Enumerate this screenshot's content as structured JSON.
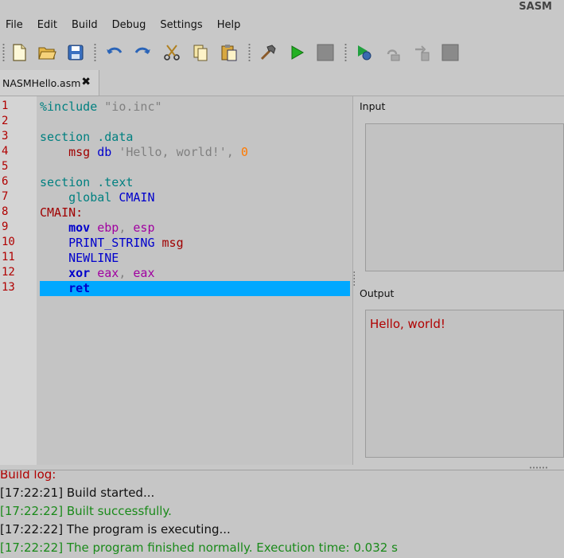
{
  "window": {
    "title": "SASM"
  },
  "menu": [
    "File",
    "Edit",
    "Build",
    "Debug",
    "Settings",
    "Help"
  ],
  "toolbar": {
    "icons": [
      "new-file-icon",
      "open-folder-icon",
      "save-icon",
      "undo-icon",
      "redo-icon",
      "cut-icon",
      "copy-icon",
      "paste-icon",
      "build-icon",
      "run-icon",
      "stop-icon",
      "debug-icon",
      "step-over-icon",
      "step-into-icon",
      "debug-stop-icon"
    ]
  },
  "tab": {
    "label": "NASMHello.asm",
    "close": "✖"
  },
  "editor": {
    "line_numbers": [
      "1",
      "2",
      "3",
      "4",
      "5",
      "6",
      "7",
      "8",
      "9",
      "10",
      "11",
      "12",
      "13"
    ],
    "highlighted_line": 13,
    "lines": [
      [
        {
          "t": "%include ",
          "c": "t-dir"
        },
        {
          "t": "\"io.inc\"",
          "c": "t-str"
        }
      ],
      [],
      [
        {
          "t": "section .data",
          "c": "t-dir"
        }
      ],
      [
        {
          "t": "    ",
          "c": "t-plain"
        },
        {
          "t": "msg",
          "c": "t-lab"
        },
        {
          "t": " ",
          "c": "t-plain"
        },
        {
          "t": "db",
          "c": "t-kw"
        },
        {
          "t": " 'Hello, world!', ",
          "c": "t-str"
        },
        {
          "t": "0",
          "c": "t-num"
        }
      ],
      [],
      [
        {
          "t": "section .text",
          "c": "t-dir"
        }
      ],
      [
        {
          "t": "    global ",
          "c": "t-dir"
        },
        {
          "t": "CMAIN",
          "c": "t-kw"
        }
      ],
      [
        {
          "t": "CMAIN:",
          "c": "t-lab"
        }
      ],
      [
        {
          "t": "    ",
          "c": "t-plain"
        },
        {
          "t": "mov",
          "c": "t-kwb"
        },
        {
          "t": " ",
          "c": "t-plain"
        },
        {
          "t": "ebp",
          "c": "t-reg"
        },
        {
          "t": ", ",
          "c": "t-str"
        },
        {
          "t": "esp",
          "c": "t-reg"
        }
      ],
      [
        {
          "t": "    ",
          "c": "t-plain"
        },
        {
          "t": "PRINT_STRING",
          "c": "t-kw"
        },
        {
          "t": " ",
          "c": "t-plain"
        },
        {
          "t": "msg",
          "c": "t-lab"
        }
      ],
      [
        {
          "t": "    ",
          "c": "t-plain"
        },
        {
          "t": "NEWLINE",
          "c": "t-kw"
        }
      ],
      [
        {
          "t": "    ",
          "c": "t-plain"
        },
        {
          "t": "xor",
          "c": "t-kwb"
        },
        {
          "t": " ",
          "c": "t-plain"
        },
        {
          "t": "eax",
          "c": "t-reg"
        },
        {
          "t": ", ",
          "c": "t-str"
        },
        {
          "t": "eax",
          "c": "t-reg"
        }
      ],
      [
        {
          "t": "    ",
          "c": "t-plain"
        },
        {
          "t": "ret",
          "c": "t-kwb"
        }
      ]
    ]
  },
  "io": {
    "input_label": "Input",
    "input_value": "",
    "output_label": "Output",
    "output_value": "Hello, world!"
  },
  "build_log": {
    "title": "Build log:",
    "entries": [
      {
        "text": "[17:22:21] Build started...",
        "status": "normal"
      },
      {
        "text": "[17:22:22] Built successfully.",
        "status": "ok"
      },
      {
        "text": "[17:22:22] The program is executing...",
        "status": "normal"
      },
      {
        "text": "[17:22:22] The program finished normally. Execution time: 0.032 s",
        "status": "ok"
      }
    ]
  },
  "colors": {
    "highlight": "#00a8ff",
    "line_number": "#b00000",
    "success": "#1a8a1a",
    "error_title": "#b00000"
  }
}
